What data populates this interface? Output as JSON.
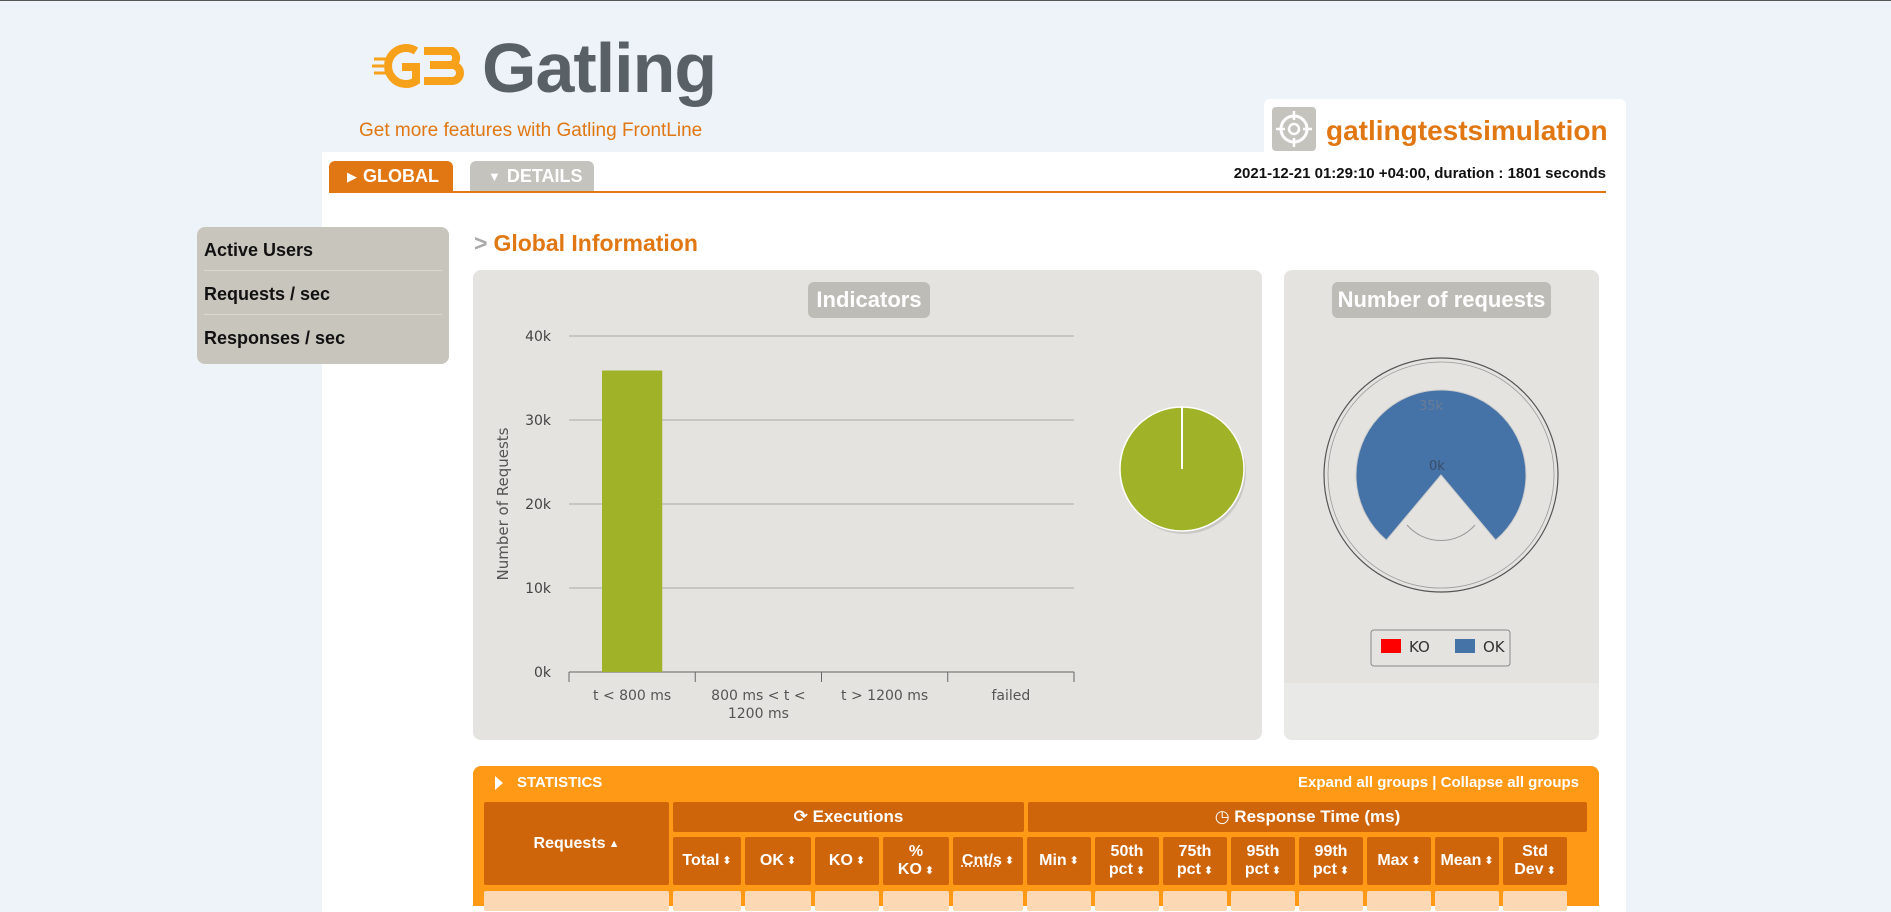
{
  "brand": {
    "name": "Gatling",
    "frontline_link": "Get more features with Gatling FrontLine"
  },
  "project": {
    "name": "gatlingtestsimulation"
  },
  "tabs": {
    "global": "GLOBAL",
    "details": "DETAILS"
  },
  "run_info": "2021-12-21 01:29:10 +04:00, duration : 1801 seconds",
  "sidebar": {
    "items": [
      {
        "label": "Active Users"
      },
      {
        "label": "Requests / sec"
      },
      {
        "label": "Responses / sec"
      }
    ]
  },
  "section": {
    "title": "Global Information",
    "marker": ">"
  },
  "indicators": {
    "title": "Indicators"
  },
  "requests_panel": {
    "title": "Number of requests",
    "legend": [
      {
        "label": "KO",
        "color": "#ff0000"
      },
      {
        "label": "OK",
        "color": "#4572a7"
      }
    ],
    "gauge_labels": [
      "35k",
      "0k"
    ]
  },
  "chart_data": [
    {
      "type": "bar",
      "categories": [
        "t < 800 ms",
        "800 ms < t < 1200 ms",
        "t > 1200 ms",
        "failed"
      ],
      "values": [
        35891,
        0,
        0,
        20
      ],
      "ylabel": "Number of Requests",
      "yticks": [
        "0k",
        "10k",
        "20k",
        "30k",
        "40k"
      ],
      "ylim": [
        0,
        40000
      ],
      "colors": [
        "#a0b228",
        "#ffdd00",
        "#ff9d00",
        "#f15b4f"
      ]
    },
    {
      "type": "pie",
      "labels": [
        "t < 800 ms",
        "failed"
      ],
      "values": [
        35891,
        20
      ],
      "colors": [
        "#a0b228",
        "#f15b4f"
      ]
    }
  ],
  "statistics": {
    "title": "STATISTICS",
    "expand": "Expand all groups",
    "separator": "|",
    "collapse": "Collapse all groups",
    "requests_header": "Requests",
    "executions_header": "Executions",
    "response_time_header": "Response Time (ms)",
    "columns": [
      "Total",
      "OK",
      "KO",
      "% KO",
      "Cnt/s",
      "Min",
      "50th pct",
      "75th pct",
      "95th pct",
      "99th pct",
      "Max",
      "Mean",
      "Std Dev"
    ]
  },
  "colors": {
    "accent": "#e07712",
    "ok": "#4572a7",
    "ko": "#ff0000",
    "bar_green": "#a0b228"
  }
}
